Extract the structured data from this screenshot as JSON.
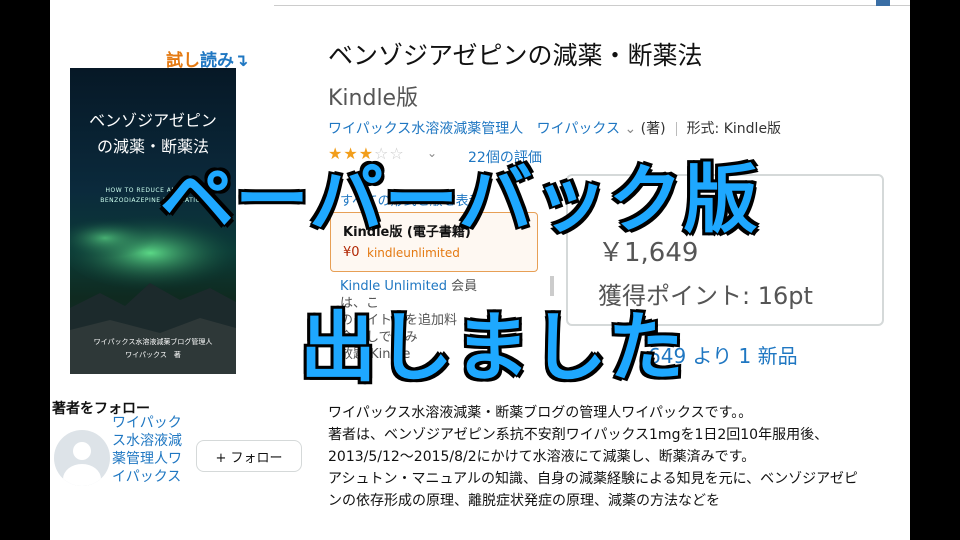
{
  "sample": {
    "part1": "試し",
    "part2": "読み",
    "arrow": "↴"
  },
  "cover": {
    "title_line1": "ベンゾジアゼピン",
    "title_line2": "の減薬・断薬法",
    "subtitle": "HOW TO REDUCE AND QUIT BENZODIAZEPINE MEDICATION",
    "author_line": "ワイパックス水溶液減薬ブログ管理人",
    "author_name": "ワイパックス　著"
  },
  "follow": {
    "heading": "著者をフォロー",
    "author_name": "ワイパックス水溶液減薬管理人ワイパックス",
    "button": "+ フォロー"
  },
  "product": {
    "title": "ベンゾジアゼピンの減薬・断薬法",
    "format": "Kindle版",
    "author_link": "ワイパックス水溶液減薬管理人",
    "author_link2": "ワイパックス",
    "role": "(著)",
    "format_label": "形式: Kindle版",
    "stars": "★★★",
    "stars_empty": "☆☆",
    "reviews": "22個の評価",
    "see_all": "すべての形式と版を表示"
  },
  "kindle_box": {
    "title": "Kindle版 (電子書籍)",
    "price": "¥0",
    "unlimited": "kindleunlimited"
  },
  "paper_box": {
    "price": "￥1,649",
    "points": "獲得ポイント: 16pt"
  },
  "ku_text": {
    "l1_link": "Kindle Unlimited",
    "l1": "会員は、こ",
    "l2": "のタイトルを追加料",
    "l3": "金なしで読み",
    "l4": "放題 Kindle"
  },
  "new_line": "649 より 1 新品",
  "description": [
    "ワイパックス水溶液減薬・断薬ブログの管理人ワイパックスです。。",
    "著者は、ベンゾジアゼピン系抗不安剤ワイパックス1mgを1日2回10年服用後、2013/5/12〜2015/8/2にかけて水溶液にて減薬し、断薬済みです。",
    "アシュトン・マニュアルの知識、自身の減薬経験による知見を元に、ベンゾジアゼピンの依存形成の原理、離脱症状発症の原理、減薬の方法などを"
  ],
  "overlay": {
    "top": "ペーパーバック版",
    "bottom": "出しました"
  },
  "colors": {
    "overlay_text": "#1ea8ff",
    "link": "#1f77c2",
    "price": "#b12704",
    "accent": "#e47911"
  }
}
